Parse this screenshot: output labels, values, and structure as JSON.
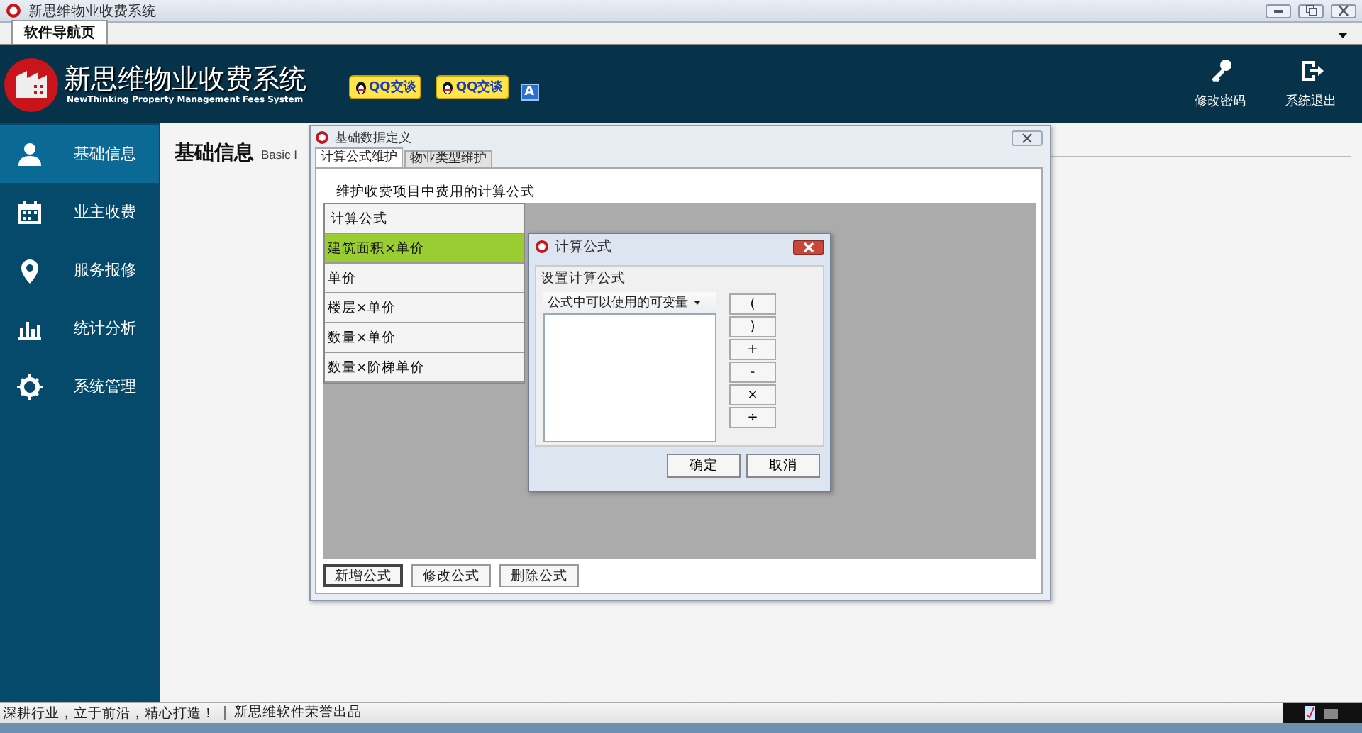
{
  "window": {
    "title": "新思维物业收费系统"
  },
  "tabs": [
    {
      "label": "软件导航页",
      "selected": true
    }
  ],
  "header": {
    "title": "新思维物业收费系统",
    "subtitle": "NewThinking  Property Management Fees System",
    "chat_badges": [
      "QQ交谈",
      "QQ交谈"
    ],
    "lang_badge": "A",
    "actions": [
      {
        "kind": "key",
        "label": "修改密码"
      },
      {
        "kind": "exit",
        "label": "系统退出"
      }
    ]
  },
  "sidebar": {
    "items": [
      {
        "kind": "user",
        "label": "基础信息",
        "selected": true
      },
      {
        "kind": "calendar",
        "label": "业主收费",
        "selected": false
      },
      {
        "kind": "pin",
        "label": "服务报修",
        "selected": false
      },
      {
        "kind": "chart",
        "label": "统计分析",
        "selected": false
      },
      {
        "kind": "gear",
        "label": "系统管理",
        "selected": false
      }
    ]
  },
  "page": {
    "title": "基础信息",
    "subtitle": "Basic I"
  },
  "dialog": {
    "title": "基础数据定义",
    "tabs": [
      {
        "label": "计算公式维护",
        "selected": true
      },
      {
        "label": "物业类型维护",
        "selected": false
      }
    ],
    "description": "维护收费项目中费用的计算公式",
    "list": {
      "header": "计算公式",
      "rows": [
        {
          "label": "建筑面积×单价",
          "selected": true
        },
        {
          "label": "单价",
          "selected": false
        },
        {
          "label": "楼层×单价",
          "selected": false
        },
        {
          "label": "数量×单价",
          "selected": false
        },
        {
          "label": "数量×阶梯单价",
          "selected": false
        }
      ]
    },
    "buttons": [
      {
        "label": "新增公式",
        "focused": true
      },
      {
        "label": "修改公式",
        "focused": false
      },
      {
        "label": "删除公式",
        "focused": false
      }
    ]
  },
  "formula_dialog": {
    "title": "计算公式",
    "group_label": "设置计算公式",
    "variables_menu": "公式中可以使用的可变量",
    "operators": [
      "(",
      ")",
      "+",
      "-",
      "×",
      "÷"
    ],
    "buttons": [
      "确定",
      "取消"
    ]
  },
  "status_bar": [
    "深耕行业，立于前沿，精心打造！",
    "新思维软件荣誉出品"
  ]
}
